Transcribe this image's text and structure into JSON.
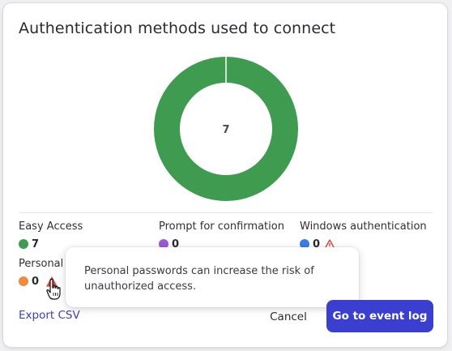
{
  "dialog": {
    "title": "Authentication methods used to connect"
  },
  "chart_data": {
    "type": "donut",
    "center_label": "7",
    "series": [
      {
        "name": "Easy Access",
        "value": 7,
        "color": "#3f9b4f"
      },
      {
        "name": "Prompt for confirmation",
        "value": 0,
        "color": "#9a5bd4"
      },
      {
        "name": "Windows authentication",
        "value": 0,
        "color": "#3b7ee8"
      },
      {
        "name": "Personal",
        "value": 0,
        "color": "#ef8a3c"
      }
    ]
  },
  "legend": [
    {
      "label": "Easy Access",
      "value": "7",
      "color": "#3f9b4f",
      "warning": false
    },
    {
      "label": "Prompt for confirmation",
      "value": "0",
      "color": "#9a5bd4",
      "warning": false
    },
    {
      "label": "Windows authentication",
      "value": "0",
      "color": "#3b7ee8",
      "warning": true
    },
    {
      "label": "Personal",
      "value": "0",
      "color": "#ef8a3c",
      "warning": true
    }
  ],
  "tooltip": {
    "text": "Personal passwords can increase the risk of unauthorized access."
  },
  "footer": {
    "export_label": "Export CSV",
    "cancel_label": "Cancel",
    "event_log_label": "Go to event log"
  },
  "colors": {
    "primary": "#3b3fcf",
    "link": "#3b3fb5",
    "warning": "#d9463b"
  }
}
